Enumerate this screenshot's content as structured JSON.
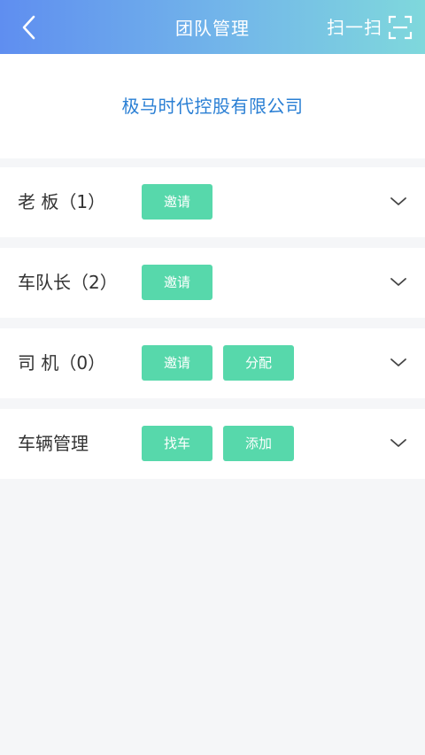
{
  "header": {
    "title": "团队管理",
    "scan_label": "扫一扫"
  },
  "company": {
    "name": "极马时代控股有限公司"
  },
  "sections": [
    {
      "label": "老 板（1）",
      "buttons": [
        "邀请"
      ]
    },
    {
      "label": "车队长（2）",
      "buttons": [
        "邀请"
      ]
    },
    {
      "label": "司 机（0）",
      "buttons": [
        "邀请",
        "分配"
      ]
    },
    {
      "label": "车辆管理",
      "buttons": [
        "找车",
        "添加"
      ]
    }
  ],
  "colors": {
    "header_gradient_start": "#5f8ef0",
    "header_gradient_end": "#7fd8dc",
    "accent_green": "#57d8ab",
    "company_blue": "#2a7fd4",
    "background": "#f5f6f8"
  },
  "icons": {
    "back": "chevron-left-icon",
    "scan": "scan-icon",
    "expand": "chevron-down-icon"
  }
}
